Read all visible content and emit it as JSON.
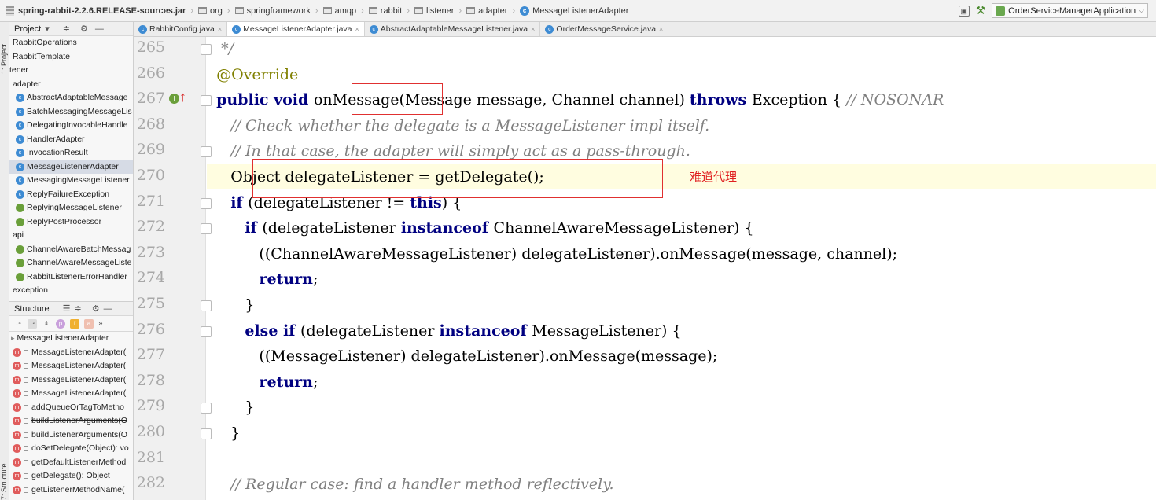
{
  "breadcrumb": {
    "items": [
      "spring-rabbit-2.2.6.RELEASE-sources.jar",
      "org",
      "springframework",
      "amqp",
      "rabbit",
      "listener",
      "adapter",
      "MessageListenerAdapter"
    ]
  },
  "run_config": "OrderServiceManagerApplication",
  "gutter_tabs": {
    "project": "1: Project",
    "structure": "7: Structure"
  },
  "project_panel": {
    "title": "Project",
    "items": [
      {
        "label": "RabbitOperations",
        "icon": "none",
        "indent": 0
      },
      {
        "label": "RabbitTemplate",
        "icon": "none",
        "indent": 0
      },
      {
        "label": "tener",
        "icon": "none",
        "indent": -1
      },
      {
        "label": "adapter",
        "icon": "folder",
        "indent": 0
      },
      {
        "label": "AbstractAdaptableMessage",
        "icon": "c",
        "indent": 1
      },
      {
        "label": "BatchMessagingMessageLis",
        "icon": "c",
        "indent": 1
      },
      {
        "label": "DelegatingInvocableHandle",
        "icon": "c",
        "indent": 1
      },
      {
        "label": "HandlerAdapter",
        "icon": "c",
        "indent": 1
      },
      {
        "label": "InvocationResult",
        "icon": "c",
        "indent": 1
      },
      {
        "label": "MessageListenerAdapter",
        "icon": "c",
        "indent": 1,
        "selected": true
      },
      {
        "label": "MessagingMessageListener",
        "icon": "c",
        "indent": 1
      },
      {
        "label": "ReplyFailureException",
        "icon": "c",
        "indent": 1
      },
      {
        "label": "ReplyingMessageListener",
        "icon": "i",
        "indent": 1
      },
      {
        "label": "ReplyPostProcessor",
        "icon": "i",
        "indent": 1
      },
      {
        "label": "api",
        "icon": "folder",
        "indent": 0
      },
      {
        "label": "ChannelAwareBatchMessag",
        "icon": "i",
        "indent": 1
      },
      {
        "label": "ChannelAwareMessageListe",
        "icon": "i",
        "indent": 1
      },
      {
        "label": "RabbitListenerErrorHandler",
        "icon": "i",
        "indent": 1
      },
      {
        "label": "exception",
        "icon": "folder",
        "indent": 0
      }
    ]
  },
  "structure_panel": {
    "title": "Structure",
    "root": "MessageListenerAdapter",
    "items": [
      {
        "label": "MessageListenerAdapter(",
        "strike": false
      },
      {
        "label": "MessageListenerAdapter(",
        "strike": false
      },
      {
        "label": "MessageListenerAdapter(",
        "strike": false
      },
      {
        "label": "MessageListenerAdapter(",
        "strike": false
      },
      {
        "label": "addQueueOrTagToMetho",
        "strike": false
      },
      {
        "label": "buildListenerArguments(O",
        "strike": true
      },
      {
        "label": "buildListenerArguments(O",
        "strike": false
      },
      {
        "label": "doSetDelegate(Object): vo",
        "strike": false
      },
      {
        "label": "getDefaultListenerMethod",
        "strike": false
      },
      {
        "label": "getDelegate(): Object",
        "strike": false
      },
      {
        "label": "getListenerMethodName(",
        "strike": false
      }
    ]
  },
  "tabs": [
    {
      "label": "RabbitConfig.java",
      "active": false,
      "icon": "c"
    },
    {
      "label": "MessageListenerAdapter.java",
      "active": true,
      "icon": "c"
    },
    {
      "label": "AbstractAdaptableMessageListener.java",
      "active": false,
      "icon": "c"
    },
    {
      "label": "OrderMessageService.java",
      "active": false,
      "icon": "c"
    }
  ],
  "editor": {
    "line_numbers": [
      "265",
      "266",
      "267",
      "268",
      "269",
      "270",
      "271",
      "272",
      "273",
      "274",
      "275",
      "276",
      "277",
      "278",
      "279",
      "280",
      "281",
      "282"
    ],
    "annotation_note": "难道代理",
    "lines": [
      [
        {
          "t": "   */",
          "c": "cm"
        }
      ],
      [
        {
          "t": "  @Override",
          "c": "ann"
        }
      ],
      [
        {
          "t": "  ",
          "c": ""
        },
        {
          "t": "public void ",
          "c": "kw"
        },
        {
          "t": "onMessage(Message message, Channel channel) ",
          "c": ""
        },
        {
          "t": "throws ",
          "c": "kw"
        },
        {
          "t": "Exception { ",
          "c": ""
        },
        {
          "t": "// NOSONAR",
          "c": "cm"
        }
      ],
      [
        {
          "t": "     // Check whether the delegate is a MessageListener impl itself.",
          "c": "cm"
        }
      ],
      [
        {
          "t": "     // In that case, the adapter will simply act as a pass-through.",
          "c": "cm"
        }
      ],
      [
        {
          "t": "     Object delegateListener = getDelegate();",
          "c": ""
        }
      ],
      [
        {
          "t": "     ",
          "c": ""
        },
        {
          "t": "if ",
          "c": "kw"
        },
        {
          "t": "(delegateListener != ",
          "c": ""
        },
        {
          "t": "this",
          "c": "kw"
        },
        {
          "t": ") {",
          "c": ""
        }
      ],
      [
        {
          "t": "        ",
          "c": ""
        },
        {
          "t": "if ",
          "c": "kw"
        },
        {
          "t": "(delegateListener ",
          "c": ""
        },
        {
          "t": "instanceof ",
          "c": "kw"
        },
        {
          "t": "ChannelAwareMessageListener) {",
          "c": ""
        }
      ],
      [
        {
          "t": "           ((ChannelAwareMessageListener) delegateListener).onMessage(message, channel);",
          "c": ""
        }
      ],
      [
        {
          "t": "           ",
          "c": ""
        },
        {
          "t": "return",
          "c": "kw"
        },
        {
          "t": ";",
          "c": ""
        }
      ],
      [
        {
          "t": "        }",
          "c": ""
        }
      ],
      [
        {
          "t": "        ",
          "c": ""
        },
        {
          "t": "else if ",
          "c": "kw"
        },
        {
          "t": "(delegateListener ",
          "c": ""
        },
        {
          "t": "instanceof ",
          "c": "kw"
        },
        {
          "t": "MessageListener) {",
          "c": ""
        }
      ],
      [
        {
          "t": "           ((MessageListener) delegateListener).onMessage(message);",
          "c": ""
        }
      ],
      [
        {
          "t": "           ",
          "c": ""
        },
        {
          "t": "return",
          "c": "kw"
        },
        {
          "t": ";",
          "c": ""
        }
      ],
      [
        {
          "t": "        }",
          "c": ""
        }
      ],
      [
        {
          "t": "     }",
          "c": ""
        }
      ],
      [
        {
          "t": "",
          "c": ""
        }
      ],
      [
        {
          "t": "     // Regular case: find a handler method reflectively.",
          "c": "cm"
        }
      ]
    ]
  }
}
